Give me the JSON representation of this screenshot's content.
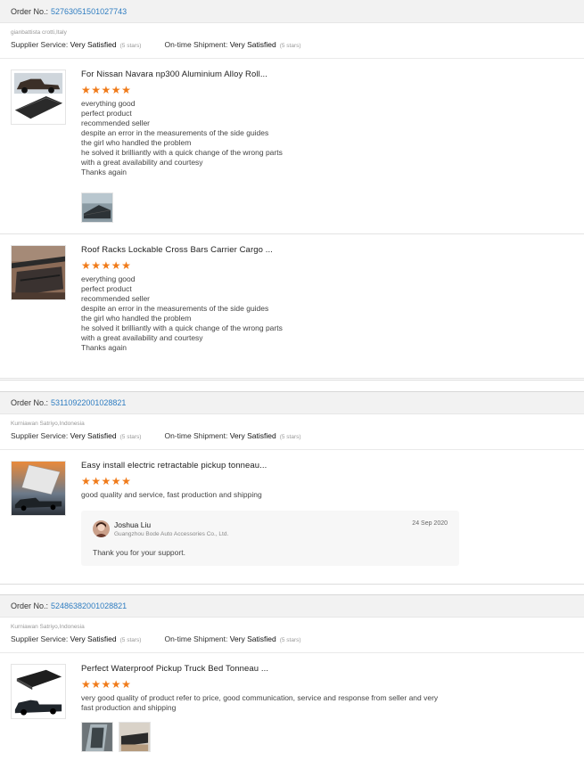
{
  "orders": [
    {
      "order_label": "Order No.:",
      "order_number": "52763051501027743",
      "buyer": "gianbattista crotti,Italy",
      "supplier_service_label": "Supplier Service:",
      "supplier_service_value": "Very Satisfied",
      "supplier_service_stars": "(5 stars)",
      "shipment_label": "On-time Shipment:",
      "shipment_value": "Very Satisfied",
      "shipment_stars": "(5 stars)",
      "items": [
        {
          "title": "For Nissan Navara np300 Aluminium Alloy Roll...",
          "stars": [
            "★",
            "★",
            "★",
            "★",
            "★"
          ],
          "review_lines": [
            "everything good",
            "perfect product",
            "recommended seller",
            "despite an error in the measurements of the side guides",
            "the girl who handled the problem",
            "he solved it brilliantly with a quick change of the wrong parts",
            "with a great availability and courtesy",
            "Thanks again"
          ]
        },
        {
          "title": "Roof Racks Lockable Cross Bars Carrier Cargo ...",
          "stars": [
            "★",
            "★",
            "★",
            "★",
            "★"
          ],
          "review_lines": [
            "everything good",
            "perfect product",
            "recommended seller",
            "despite an error in the measurements of the side guides",
            "the girl who handled the problem",
            "he solved it brilliantly with a quick change of the wrong parts",
            "with a great availability and courtesy",
            "Thanks again"
          ]
        }
      ]
    },
    {
      "order_label": "Order No.:",
      "order_number": "53110922001028821",
      "buyer": "Kurniawan Satriyo,Indonesia",
      "supplier_service_label": "Supplier Service:",
      "supplier_service_value": "Very Satisfied",
      "supplier_service_stars": "(5 stars)",
      "shipment_label": "On-time Shipment:",
      "shipment_value": "Very Satisfied",
      "shipment_stars": "(5 stars)",
      "items": [
        {
          "title": "Easy install electric retractable pickup tonneau...",
          "stars": [
            "★",
            "★",
            "★",
            "★",
            "★"
          ],
          "review_lines": [
            "good quality and service, fast production and shipping"
          ],
          "reply": {
            "name": "Joshua Liu",
            "company": "Guangzhou Bode Auto Accessories Co., Ltd.",
            "date": "24 Sep 2020",
            "text": "Thank you for your support."
          }
        }
      ]
    },
    {
      "order_label": "Order No.:",
      "order_number": "52486382001028821",
      "buyer": "Kurniawan Satriyo,Indonesia",
      "supplier_service_label": "Supplier Service:",
      "supplier_service_value": "Very Satisfied",
      "supplier_service_stars": "(5 stars)",
      "shipment_label": "On-time Shipment:",
      "shipment_value": "Very Satisfied",
      "shipment_stars": "(5 stars)",
      "items": [
        {
          "title": "Perfect Waterproof Pickup Truck Bed Tonneau ...",
          "stars": [
            "★",
            "★",
            "★",
            "★",
            "★"
          ],
          "review_lines": [
            "very good quality of product refer to price, good communication, service and response from seller and very fast production and shipping"
          ]
        }
      ]
    }
  ],
  "colors": {
    "accent_link": "#2f7dc1",
    "star": "#f07b1a",
    "header_bg": "#f2f2f2"
  }
}
